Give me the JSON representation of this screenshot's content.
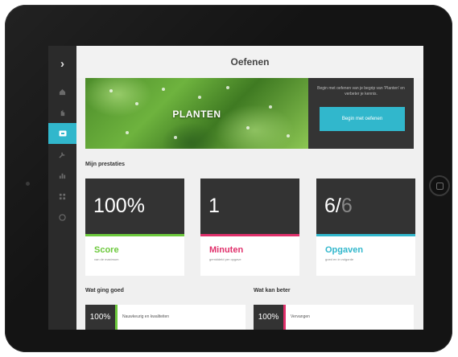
{
  "header": {
    "title": "Oefenen"
  },
  "sidebar": {
    "expand_glyph": "›",
    "items": [
      {
        "icon": "home-icon",
        "active": false
      },
      {
        "icon": "hand-icon",
        "active": false
      },
      {
        "icon": "practice-icon",
        "active": true
      },
      {
        "icon": "tools-icon",
        "active": false
      },
      {
        "icon": "chart-icon",
        "active": false
      },
      {
        "icon": "grid-icon",
        "active": false
      },
      {
        "icon": "info-icon",
        "active": false
      }
    ]
  },
  "banner": {
    "title": "PLANTEN",
    "description": "Begin met oefenen van je begrip van 'Planten' en verbeter je kennis.",
    "button_label": "Begin met oefenen"
  },
  "performance": {
    "title": "Mijn prestaties",
    "cards": [
      {
        "value": "100%",
        "label": "Score",
        "sub": "van de maximum",
        "color": "#6cc93c"
      },
      {
        "value": "1",
        "label": "Minuten",
        "sub": "gemiddeld per opgave",
        "color": "#e0306b"
      },
      {
        "value_main": "6/",
        "value_faded": "6",
        "label": "Opgaven",
        "sub": "goed en in volgorde",
        "color": "#31b7cc"
      }
    ]
  },
  "good": {
    "title": "Wat ging goed",
    "items": [
      {
        "pct": "100%",
        "text": "Nauwkeurig en kwaliteiten",
        "color": "#6cc93c"
      }
    ]
  },
  "improve": {
    "title": "Wat kan beter",
    "items": [
      {
        "pct": "100%",
        "text": "Vervangen",
        "color": "#e0306b"
      }
    ]
  }
}
